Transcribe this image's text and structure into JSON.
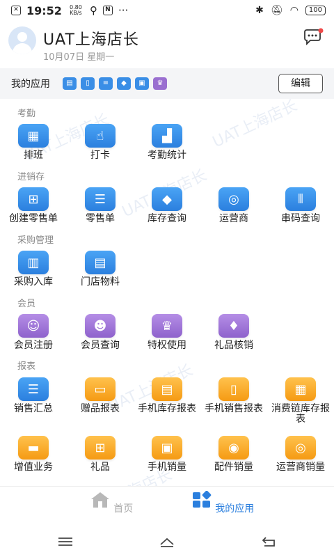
{
  "status_bar": {
    "time": "19:52",
    "speed_value": "0.80",
    "speed_unit": "KB/s",
    "more": "···",
    "battery": "100"
  },
  "header": {
    "store_name": "UAT上海店长",
    "date": "10月07日",
    "weekday": "星期一"
  },
  "apps_bar": {
    "title": "我的应用",
    "edit_label": "编辑"
  },
  "sections": {
    "attendance": {
      "title": "考勤",
      "items": [
        "排班",
        "打卡",
        "考勤统计"
      ]
    },
    "inventory": {
      "title": "进销存",
      "items": [
        "创建零售单",
        "零售单",
        "库存查询",
        "运营商",
        "串码查询"
      ]
    },
    "purchase": {
      "title": "采购管理",
      "items": [
        "采购入库",
        "门店物料"
      ]
    },
    "member": {
      "title": "会员",
      "items": [
        "会员注册",
        "会员查询",
        "特权使用",
        "礼品核销"
      ]
    },
    "reports": {
      "title": "报表",
      "items": [
        "销售汇总",
        "赠品报表",
        "手机库存报表",
        "手机销售报表",
        "消费链库存报表",
        "增值业务",
        "礼品",
        "手机销量",
        "配件销量",
        "运营商销量"
      ]
    }
  },
  "watermark": "UAT上海店长",
  "tabbar": {
    "home": "首页",
    "apps": "我的应用"
  },
  "colors": {
    "accent": "#2b7fde",
    "purple": "#8e62cc",
    "orange": "#f59a13"
  }
}
